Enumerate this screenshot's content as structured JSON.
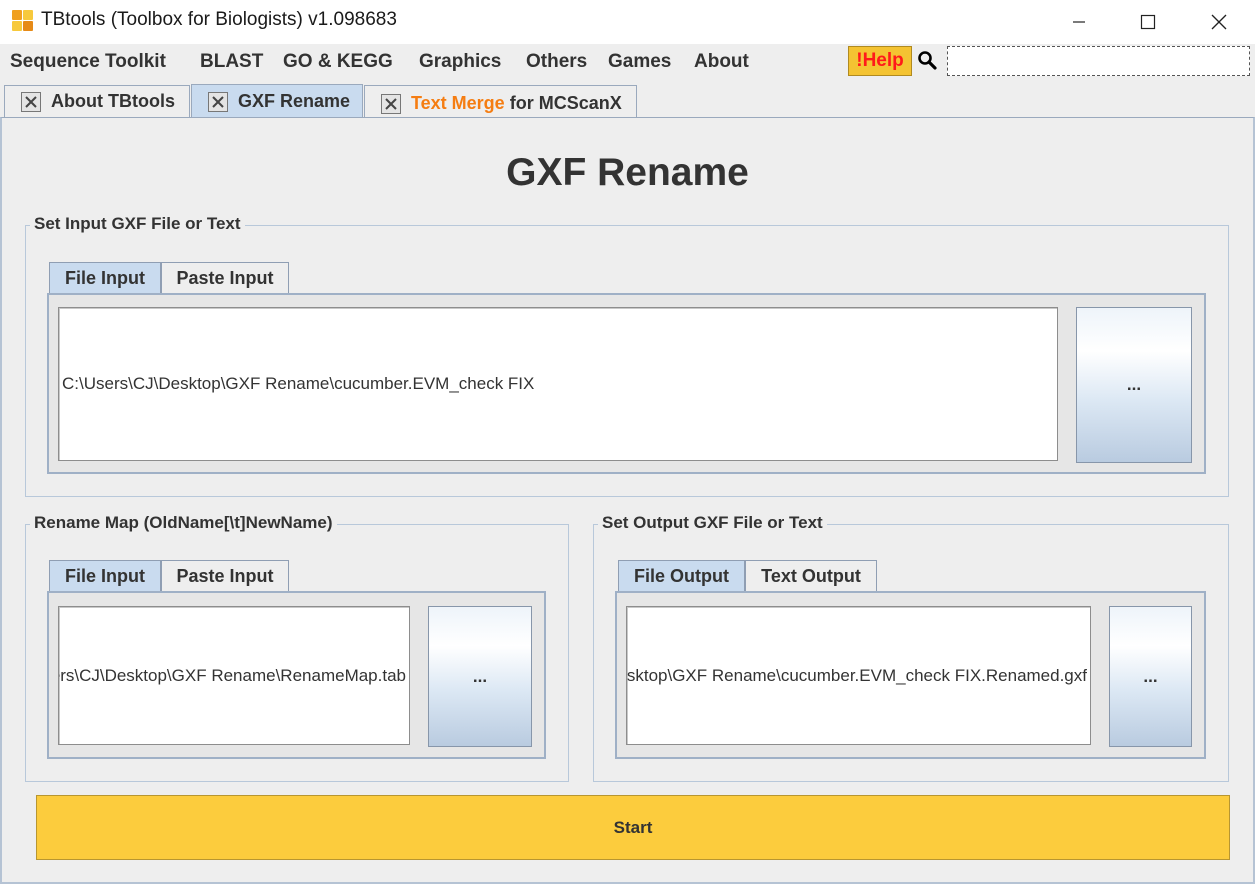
{
  "window": {
    "title": "TBtools (Toolbox for Biologists) v1.098683"
  },
  "menu": {
    "items": [
      "Sequence Toolkit",
      "BLAST",
      "GO & KEGG",
      "Graphics",
      "Others",
      "Games",
      "About"
    ],
    "help_label": "!Help",
    "search_value": ""
  },
  "tabs": {
    "about": "About TBtools",
    "gxf_rename": "GXF Rename",
    "text_merge_highlight": "Text Merge",
    "text_merge_rest": " for MCScanX"
  },
  "page": {
    "title": "GXF Rename",
    "start_label": "Start",
    "browse_label": "..."
  },
  "input_group": {
    "title": "Set Input GXF File or Text",
    "tab_file": "File Input",
    "tab_paste": "Paste Input",
    "path": "C:\\Users\\CJ\\Desktop\\GXF Rename\\cucumber.EVM_check FIX"
  },
  "map_group": {
    "title": "Rename Map (OldName[\\t]NewName)",
    "tab_file": "File Input",
    "tab_paste": "Paste Input",
    "path": "C:\\Users\\CJ\\Desktop\\GXF Rename\\RenameMap.tab"
  },
  "output_group": {
    "title": "Set Output GXF File or Text",
    "tab_file": "File Output",
    "tab_text": "Text Output",
    "path": "C:\\Users\\CJ\\Desktop\\GXF Rename\\cucumber.EVM_check FIX.Renamed.gxf"
  },
  "colors": {
    "accent_tab": "#c9dbef",
    "start_button": "#fccc3d",
    "help_button": "#f4c332",
    "help_text": "#ff1a1a",
    "highlight_text": "#f57d12"
  }
}
